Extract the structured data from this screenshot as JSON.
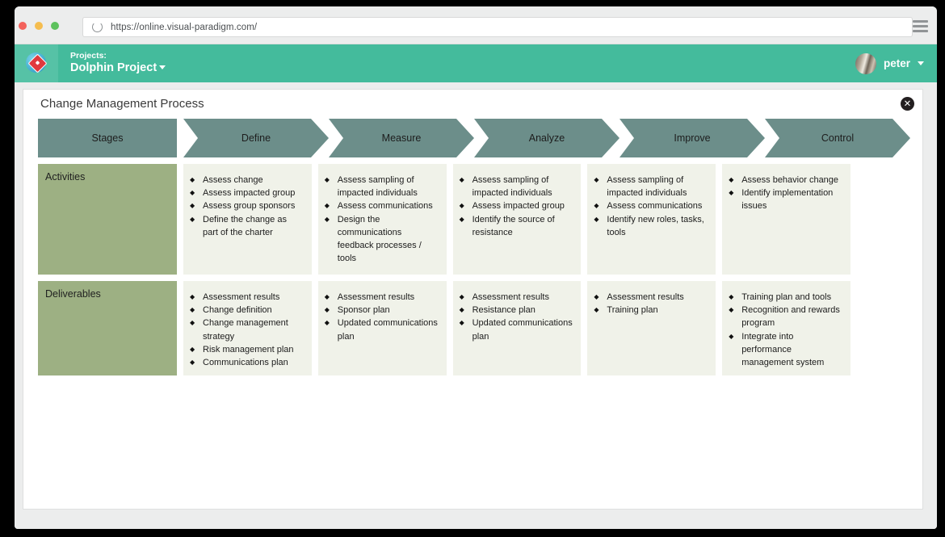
{
  "browser": {
    "url": "https://online.visual-paradigm.com/",
    "reload_icon": "reload-icon",
    "menu_icon": "hamburger-menu-icon",
    "traffic_lights": [
      "close",
      "minimize",
      "maximize"
    ]
  },
  "app_header": {
    "logo_icon": "visual-paradigm-logo",
    "projects_label": "Projects:",
    "project_name": "Dolphin Project",
    "project_caret_icon": "chevron-down-icon",
    "user_name": "peter",
    "user_caret_icon": "chevron-down-icon",
    "avatar_icon": "user-avatar",
    "accent_color": "#44bb9c"
  },
  "diagram": {
    "title": "Change Management Process",
    "close_icon": "✕",
    "colors": {
      "header_cell": "#6c8e8a",
      "row_label_cell": "#9db083",
      "data_cell": "#f0f2e9",
      "canvas": "#ffffff"
    },
    "header": {
      "stages_label": "Stages",
      "stages": [
        "Define",
        "Measure",
        "Analyze",
        "Improve",
        "Control"
      ]
    },
    "rows": [
      {
        "label": "Activities",
        "cells": [
          [
            "Assess change",
            "Assess impacted group",
            "Assess group sponsors",
            "Define the change as part of the charter"
          ],
          [
            "Assess sampling of impacted individuals",
            "Assess communications",
            "Design the communications feedback processes / tools"
          ],
          [
            "Assess sampling of impacted individuals",
            "Assess impacted group",
            "Identify the source of resistance"
          ],
          [
            "Assess sampling of impacted individuals",
            "Assess communications",
            "Identify new roles, tasks, tools"
          ],
          [
            "Assess behavior change",
            "Identify implementation issues"
          ]
        ]
      },
      {
        "label": "Deliverables",
        "cells": [
          [
            "Assessment results",
            "Change definition",
            "Change management strategy",
            "Risk management plan",
            "Communications plan"
          ],
          [
            "Assessment results",
            "Sponsor plan",
            "Updated communications plan"
          ],
          [
            "Assessment results",
            "Resistance plan",
            "Updated communications plan"
          ],
          [
            "Assessment results",
            "Training plan"
          ],
          [
            "Training plan and tools",
            "Recognition and rewards program",
            "Integrate into performance management system"
          ]
        ]
      }
    ]
  }
}
